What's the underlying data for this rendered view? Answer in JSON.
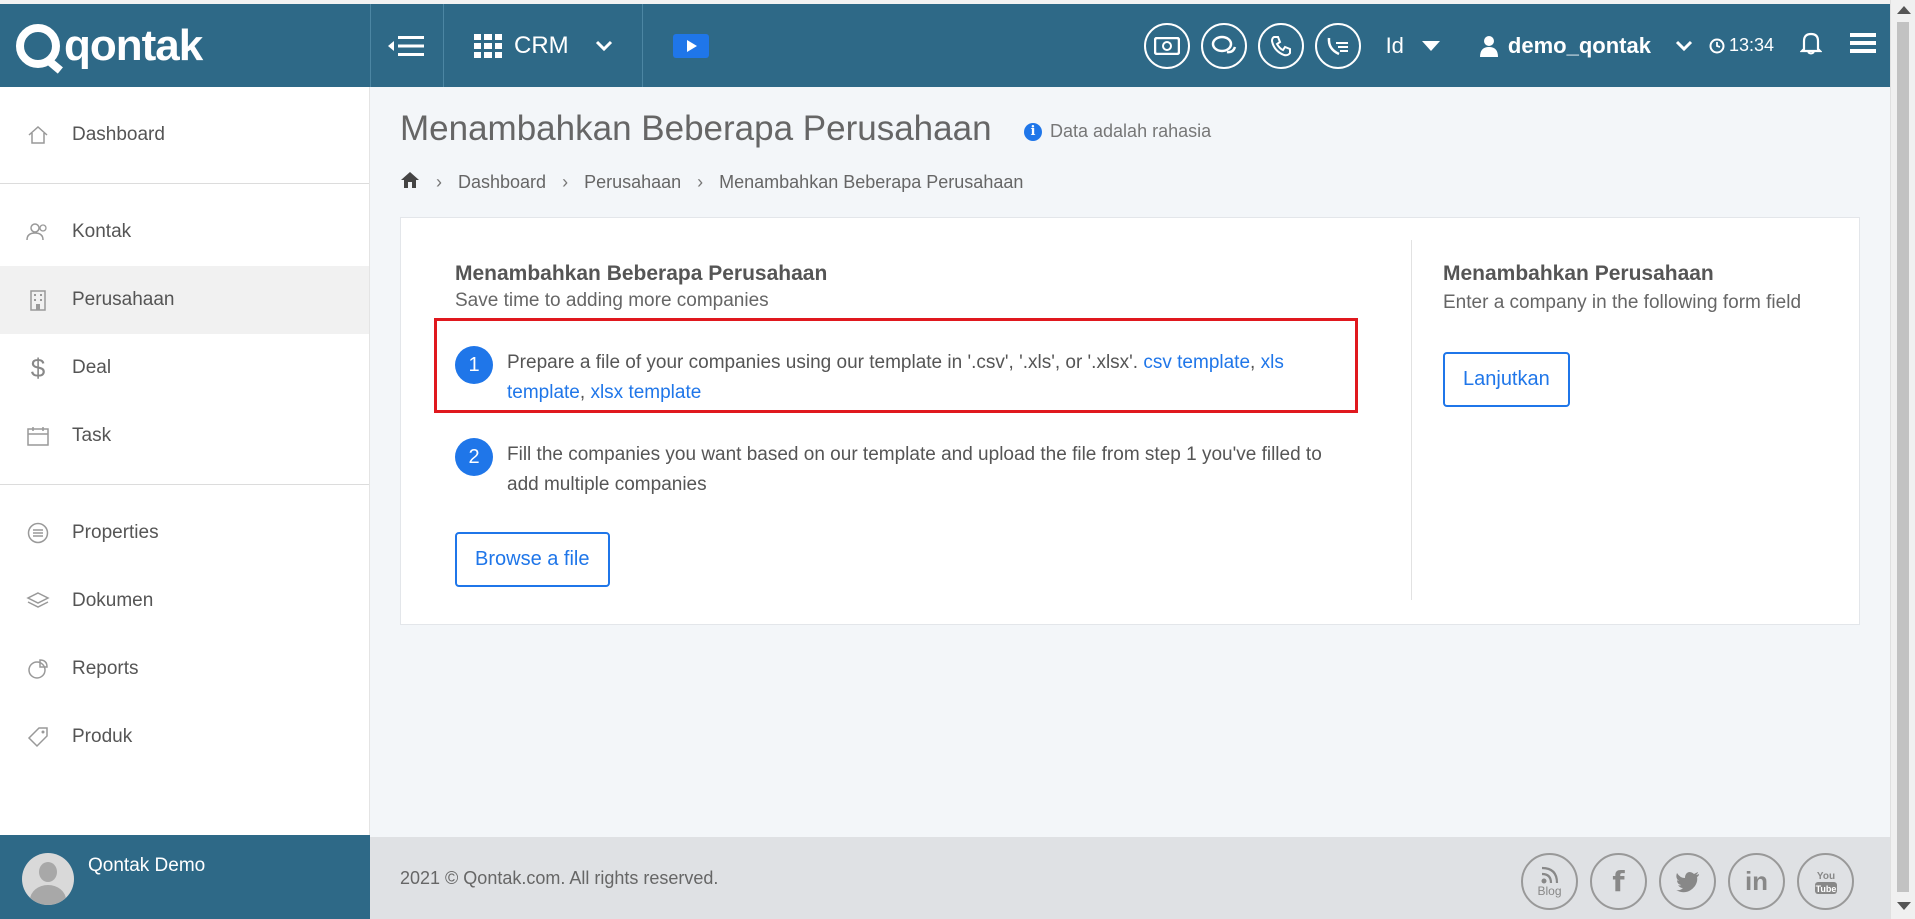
{
  "brand": {
    "logo_text": "qontak"
  },
  "topbar": {
    "module": "CRM",
    "language": "Id",
    "username": "demo_qontak",
    "time": "13:34"
  },
  "sidebar": {
    "items": [
      {
        "label": "Dashboard",
        "icon": "home-icon"
      },
      {
        "label": "Kontak",
        "icon": "users-icon"
      },
      {
        "label": "Perusahaan",
        "icon": "building-icon",
        "active": true
      },
      {
        "label": "Deal",
        "icon": "dollar-icon"
      },
      {
        "label": "Task",
        "icon": "calendar-icon"
      },
      {
        "label": "Properties",
        "icon": "list-icon"
      },
      {
        "label": "Dokumen",
        "icon": "layers-icon"
      },
      {
        "label": "Reports",
        "icon": "pie-chart-icon"
      },
      {
        "label": "Produk",
        "icon": "tag-icon"
      }
    ],
    "profile_name": "Qontak Demo"
  },
  "page": {
    "title": "Menambahkan Beberapa Perusahaan",
    "confidential_note": "Data adalah rahasia",
    "breadcrumb": [
      "Dashboard",
      "Perusahaan",
      "Menambahkan Beberapa Perusahaan"
    ]
  },
  "card": {
    "left_title": "Menambahkan Beberapa Perusahaan",
    "left_subtitle": "Save time to adding more companies",
    "step1": {
      "number": "1",
      "text": "Prepare a file of your companies using our template in '.csv', '.xls', or '.xlsx'. ",
      "link_csv": "csv template",
      "link_xls": "xls template",
      "link_xlsx": "xlsx template"
    },
    "step2": {
      "number": "2",
      "text": "Fill the companies you want based on our template and upload the file from step 1 you've filled to add multiple companies"
    },
    "browse_label": "Browse a file",
    "right_title": "Menambahkan Perusahaan",
    "right_subtitle": "Enter a company in the following form field",
    "continue_label": "Lanjutkan"
  },
  "footer": {
    "copyright": "2021 © Qontak.com. All rights reserved.",
    "socials": [
      {
        "icon": "blog-icon",
        "label": "Blog"
      },
      {
        "icon": "facebook-icon",
        "glyph": "f"
      },
      {
        "icon": "twitter-icon",
        "glyph": "t"
      },
      {
        "icon": "linkedin-icon",
        "glyph": "in"
      },
      {
        "icon": "youtube-icon",
        "glyph": "You Tube"
      }
    ]
  }
}
